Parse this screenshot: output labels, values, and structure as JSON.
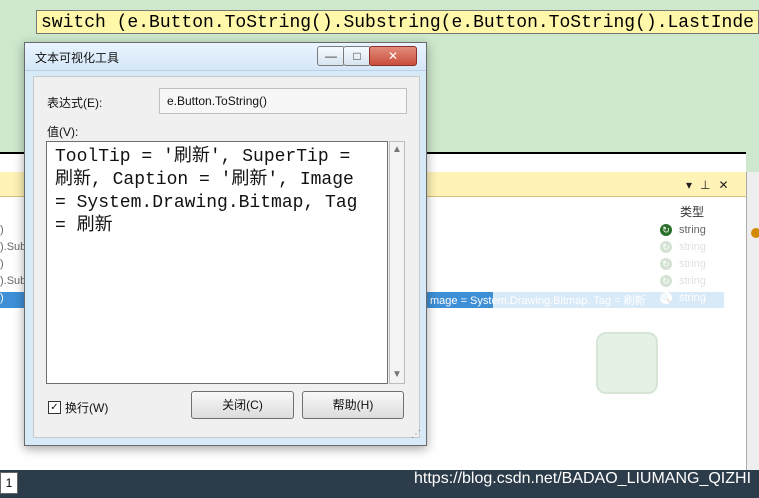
{
  "editor": {
    "code_line": "switch (e.Button.ToString().Substring(e.Button.ToString().LastInde"
  },
  "panel": {
    "title": "",
    "type_header": "类型",
    "controls": [
      "▾",
      "⊥",
      "✕"
    ],
    "rows": [
      {
        "label": ")",
        "value": "",
        "type": "string",
        "selected": false
      },
      {
        "label": ").Subs",
        "value": "",
        "type": "string",
        "selected": false
      },
      {
        "label": ")",
        "value": "",
        "type": "string",
        "selected": false
      },
      {
        "label": ").Subs",
        "value": "",
        "type": "string",
        "selected": false
      },
      {
        "label": ")",
        "value": "mage = System.Drawing.Bitmap, Tag = 刷新",
        "type": "string",
        "selected": true
      }
    ]
  },
  "status_bar": {
    "page_number": "1",
    "watermark": "https://blog.csdn.net/BADAO_LIUMANG_QIZHI"
  },
  "dialog": {
    "title": "文本可视化工具",
    "window_buttons": {
      "minimize": "—",
      "maximize": "□",
      "close": "✕"
    },
    "expression_label": "表达式(E):",
    "expression_value": "e.Button.ToString()",
    "value_label": "值(V):",
    "value_text": "ToolTip = '刷新', SuperTip =\n刷新, Caption = '刷新', Image\n= System.Drawing.Bitmap, Tag\n= 刷新",
    "wrap_label": "换行(W)",
    "wrap_checked": true,
    "close_button": "关闭(C)",
    "help_button": "帮助(H)"
  }
}
